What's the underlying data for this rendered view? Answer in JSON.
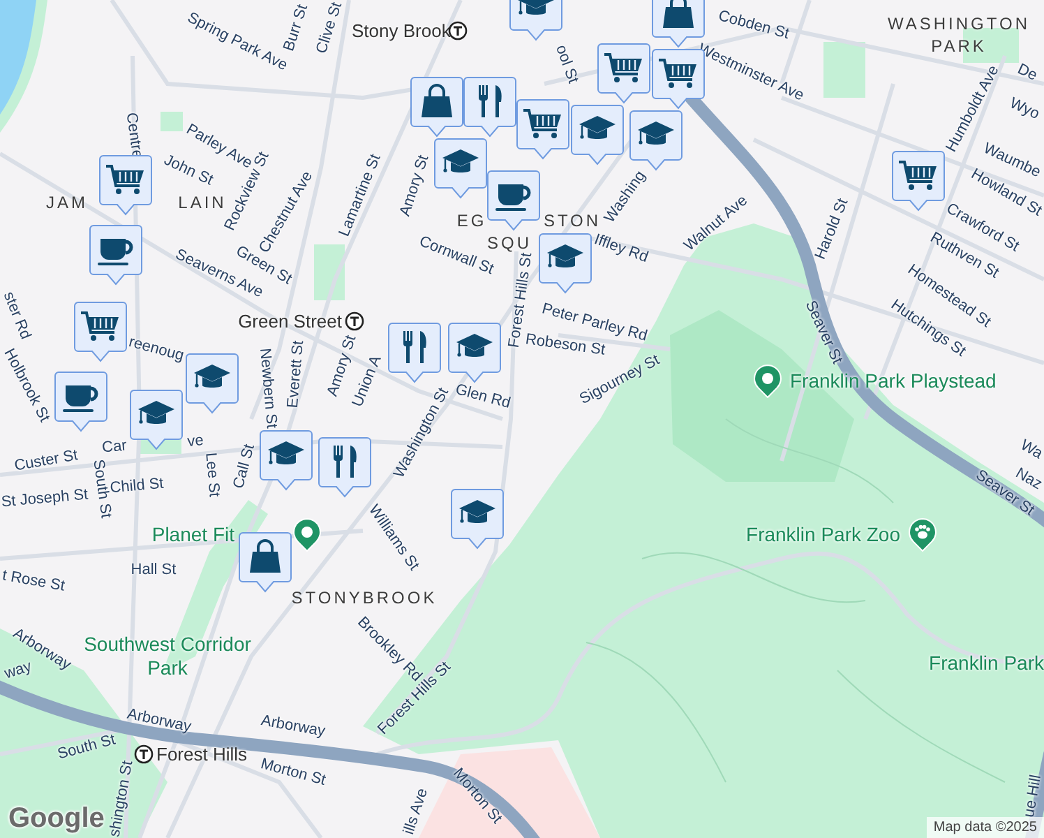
{
  "map": {
    "street_labels": [
      "Spring Park Ave",
      "Burr St",
      "Clive St",
      "Centre",
      "Parley Ave",
      "John St",
      "Rockview St",
      "Chestnut Ave",
      "Green St",
      "Seaverns Ave",
      "Lamartine St",
      "Amory St",
      "ool St",
      "Washing",
      "Cornwall St",
      "Iffley Rd",
      "Forest Hills St",
      "Peter Parley Rd",
      "Robeson St",
      "Sigourney St",
      "Walnut Ave",
      "Cobden St",
      "Westminster Ave",
      "Harold St",
      "Humboldt Ave",
      "Waumbe",
      "Wyo",
      "De",
      "Howland St",
      "Crawford St",
      "Ruthven St",
      "Homestead St",
      "Hutchings St",
      "Seaver St",
      "Seaver St",
      "Wa",
      "Naz",
      "Holbrook St",
      "ster Rd",
      "reenoug",
      "Newbern St",
      "Everett St",
      "Amory St",
      "Union A",
      "Washington St",
      "Glen Rd",
      "Car",
      "ve",
      "Custer St",
      "South St",
      "St Joseph St",
      "Child St",
      "Lee St",
      "Call St",
      "Williams St",
      "t Rose St",
      "Hall St",
      "Arborway",
      "way",
      "Arborway",
      "Arborway",
      "South St",
      "shington St",
      "Morton St",
      "Brookley Rd",
      "Forest Hills St",
      "Morton St",
      "ills Ave",
      "ue Hill"
    ],
    "area_labels": [
      "WASHINGTON",
      "PARK",
      "JAM",
      "LAIN",
      "EG",
      "STON",
      "SQU",
      "STONYBROOK"
    ],
    "stations": [
      "Stony Brook",
      "Green Street",
      "Forest Hills"
    ],
    "places": [
      {
        "name": "Franklin Park Playstead",
        "kind": "park"
      },
      {
        "name": "Planet Fit",
        "kind": "gym"
      },
      {
        "name": "Franklin Park Zoo",
        "kind": "zoo"
      },
      {
        "name": "Southwest Corridor Park",
        "kind": "area"
      },
      {
        "name": "Franklin Park",
        "kind": "area"
      }
    ],
    "markers": [
      {
        "kind": "education"
      },
      {
        "kind": "shopping-bag"
      },
      {
        "kind": "shopping-cart"
      },
      {
        "kind": "shopping-cart"
      },
      {
        "kind": "education"
      },
      {
        "kind": "education"
      },
      {
        "kind": "shopping-bag"
      },
      {
        "kind": "restaurant"
      },
      {
        "kind": "shopping-cart"
      },
      {
        "kind": "education"
      },
      {
        "kind": "cafe"
      },
      {
        "kind": "education"
      },
      {
        "kind": "shopping-cart"
      },
      {
        "kind": "shopping-cart"
      },
      {
        "kind": "cafe"
      },
      {
        "kind": "shopping-cart"
      },
      {
        "kind": "cafe"
      },
      {
        "kind": "education"
      },
      {
        "kind": "education"
      },
      {
        "kind": "restaurant"
      },
      {
        "kind": "education"
      },
      {
        "kind": "education"
      },
      {
        "kind": "restaurant"
      },
      {
        "kind": "shopping-bag"
      },
      {
        "kind": "education"
      }
    ]
  },
  "logo": "Google",
  "attribution": "Map data ©2025"
}
